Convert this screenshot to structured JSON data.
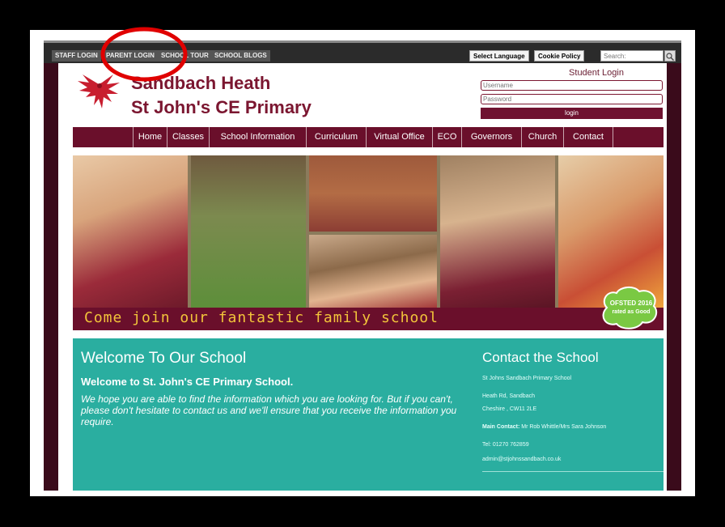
{
  "topbar": {
    "links": [
      "STAFF LOGIN",
      "PARENT LOGIN",
      "SCHOOL TOUR",
      "SCHOOL BLOGS"
    ],
    "select_language": "Select Language",
    "cookie_policy": "Cookie Policy",
    "search_placeholder": "Search:"
  },
  "header": {
    "name_line1": "Sandbach Heath",
    "name_line2": "St John's CE Primary"
  },
  "student_login": {
    "title": "Student Login",
    "username_placeholder": "Username",
    "password_placeholder": "Password",
    "button": "login"
  },
  "nav": {
    "items": [
      "Home",
      "Classes",
      "School Information",
      "Curriculum",
      "Virtual Office",
      "ECO",
      "Governors",
      "Church",
      "Contact"
    ]
  },
  "hero": {
    "banner": "Come join our fantastic family school",
    "ofsted_line1": "OFSTED 2016",
    "ofsted_line2": "rated as Good"
  },
  "welcome": {
    "heading": "Welcome To Our School",
    "subheading": "Welcome to St. John's CE Primary School.",
    "body": "We hope you are able to find the information which you are looking for. But if you can't, please don't hesitate to contact us and we'll ensure that you receive the information you require."
  },
  "contact": {
    "heading": "Contact the School",
    "school": "St Johns Sandbach Primary School",
    "address1": "Heath Rd, Sandbach",
    "address2": "Cheshire , CW11 2LE",
    "main_contact_label": "Main Contact:",
    "main_contact_value": "Mr Rob Whittle/Mrs Sara Johnson",
    "tel": "Tel: 01270 762859",
    "email": "admin@stjohnssandbach.co.uk"
  },
  "colors": {
    "maroon": "#6a0f2b",
    "teal": "#2aaea0",
    "banner_text": "#f2c43a",
    "annotation_red": "#e00000"
  }
}
